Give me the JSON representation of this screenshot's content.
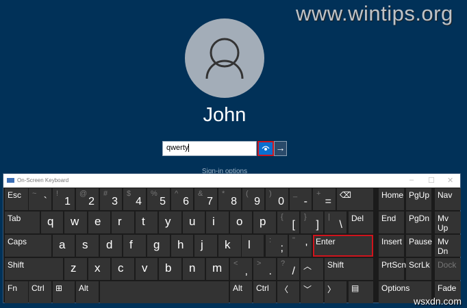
{
  "watermark": "www.wintips.org",
  "watermark2": "wsxdn.com",
  "login": {
    "username": "John",
    "password_value": "qwerty",
    "signin_options": "Sign-in options",
    "submit_icon": "arrow-right-icon",
    "reveal_icon": "eye-icon"
  },
  "osk": {
    "title": "On-Screen Keyboard",
    "window_buttons": [
      "–",
      "☐",
      "✕"
    ],
    "keys": [
      {
        "label": "Esc"
      },
      {
        "label": "`",
        "sub": "~"
      },
      {
        "label": "1",
        "sub": "!"
      },
      {
        "label": "2",
        "sub": "@"
      },
      {
        "label": "3",
        "sub": "#"
      },
      {
        "label": "4",
        "sub": "$"
      },
      {
        "label": "5",
        "sub": "%"
      },
      {
        "label": "6",
        "sub": "^"
      },
      {
        "label": "7",
        "sub": "&"
      },
      {
        "label": "8",
        "sub": "*"
      },
      {
        "label": "9",
        "sub": "("
      },
      {
        "label": "0",
        "sub": ")"
      },
      {
        "label": "-",
        "sub": "_"
      },
      {
        "label": "=",
        "sub": "+"
      },
      {
        "label": "⌫"
      },
      {
        "label": "Tab"
      },
      {
        "label": "q"
      },
      {
        "label": "w"
      },
      {
        "label": "e"
      },
      {
        "label": "r"
      },
      {
        "label": "t"
      },
      {
        "label": "y"
      },
      {
        "label": "u"
      },
      {
        "label": "i"
      },
      {
        "label": "o"
      },
      {
        "label": "p"
      },
      {
        "label": "[",
        "sub": "{"
      },
      {
        "label": "]",
        "sub": "}"
      },
      {
        "label": "\\",
        "sub": "|"
      },
      {
        "label": "Del"
      },
      {
        "label": "Caps"
      },
      {
        "label": "a"
      },
      {
        "label": "s"
      },
      {
        "label": "d"
      },
      {
        "label": "f"
      },
      {
        "label": "g"
      },
      {
        "label": "h"
      },
      {
        "label": "j"
      },
      {
        "label": "k"
      },
      {
        "label": "l"
      },
      {
        "label": ";",
        "sub": ":"
      },
      {
        "label": "'",
        "sub": "\""
      },
      {
        "label": "Enter"
      },
      {
        "label": "Shift"
      },
      {
        "label": "z"
      },
      {
        "label": "x"
      },
      {
        "label": "c"
      },
      {
        "label": "v"
      },
      {
        "label": "b"
      },
      {
        "label": "n"
      },
      {
        "label": "m"
      },
      {
        "label": ",",
        "sub": "<"
      },
      {
        "label": ".",
        "sub": ">"
      },
      {
        "label": "/",
        "sub": "?"
      },
      {
        "label": "︿"
      },
      {
        "label": "Shift"
      },
      {
        "label": "Fn"
      },
      {
        "label": "Ctrl"
      },
      {
        "label": "⊞"
      },
      {
        "label": "Alt"
      },
      {
        "label": ""
      },
      {
        "label": "Alt"
      },
      {
        "label": "Ctrl"
      },
      {
        "label": "〈"
      },
      {
        "label": "﹀"
      },
      {
        "label": "〉"
      },
      {
        "label": "▤"
      },
      {
        "label": "Home"
      },
      {
        "label": "PgUp"
      },
      {
        "label": "Nav"
      },
      {
        "label": "End"
      },
      {
        "label": "PgDn"
      },
      {
        "label": "Mv Up"
      },
      {
        "label": "Insert"
      },
      {
        "label": "Pause"
      },
      {
        "label": "Mv Dn"
      },
      {
        "label": "PrtScn"
      },
      {
        "label": "ScrLk"
      },
      {
        "label": "Dock"
      },
      {
        "label": "Options"
      },
      {
        "label": "Fade"
      }
    ],
    "highlighted_key": "Enter",
    "disabled_keys": [
      "Dock"
    ]
  }
}
